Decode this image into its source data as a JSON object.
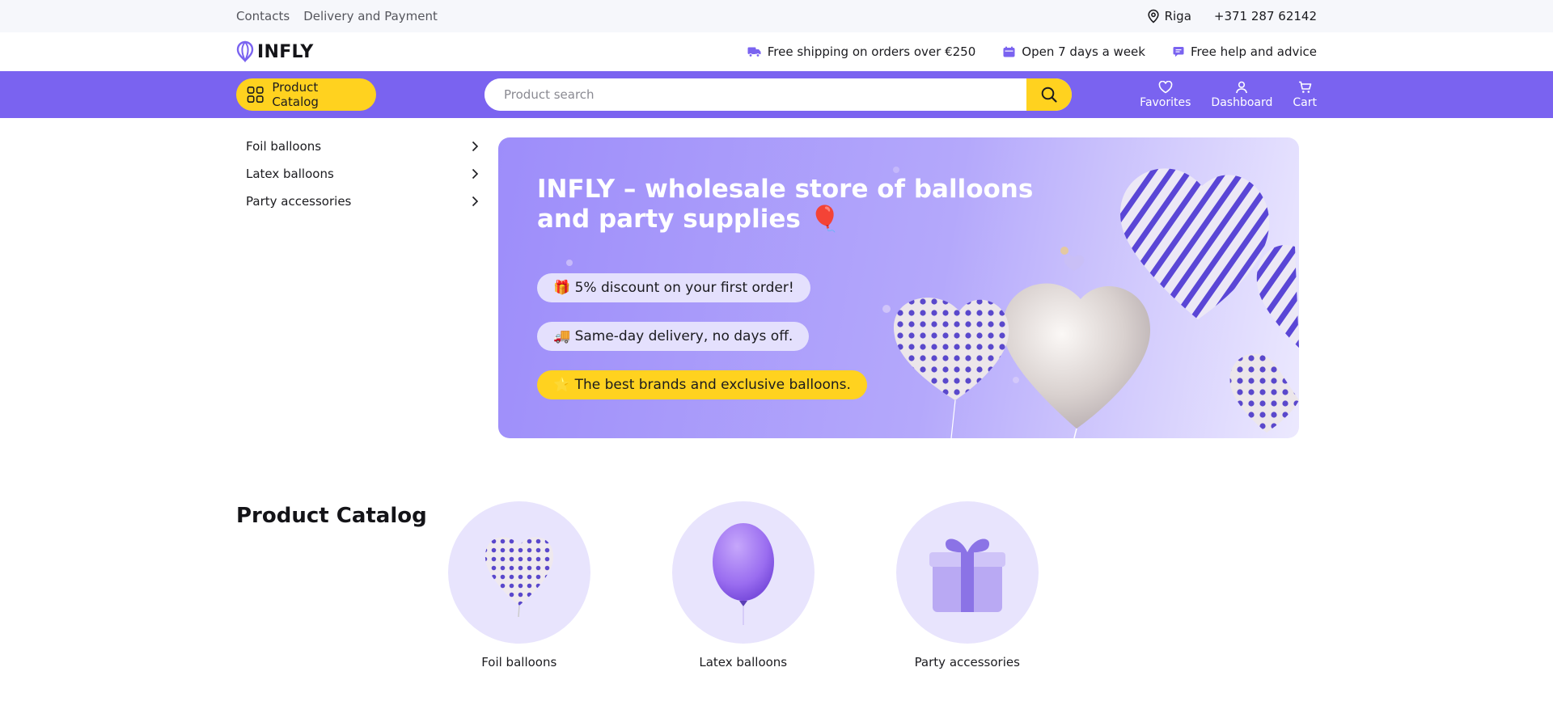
{
  "topbar": {
    "links": [
      "Contacts",
      "Delivery and Payment"
    ],
    "city": "Riga",
    "phone": "+371 287 62142"
  },
  "header": {
    "logo_text": "INFLY",
    "perks": [
      {
        "icon": "truck-icon",
        "label": "Free shipping on orders over €250"
      },
      {
        "icon": "calendar-icon",
        "label": "Open 7 days a week"
      },
      {
        "icon": "chat-icon",
        "label": "Free help and advice"
      }
    ]
  },
  "navbar": {
    "catalog_label": "Product Catalog",
    "search_placeholder": "Product search",
    "actions": [
      {
        "icon": "heart-icon",
        "label": "Favorites"
      },
      {
        "icon": "user-icon",
        "label": "Dashboard"
      },
      {
        "icon": "cart-icon",
        "label": "Cart"
      }
    ]
  },
  "sidebar": {
    "items": [
      "Foil balloons",
      "Latex balloons",
      "Party accessories"
    ]
  },
  "hero": {
    "title": "INFLY – wholesale store of balloons and party supplies 🎈",
    "pills": [
      "🎁 5% discount on your first order!",
      "🚚 Same-day delivery, no days off.",
      "⭐ The best brands and exclusive balloons."
    ]
  },
  "catalog": {
    "title": "Product Catalog",
    "categories": [
      "Foil balloons",
      "Latex balloons",
      "Party accessories"
    ]
  },
  "colors": {
    "accent_purple": "#7a63f0",
    "accent_yellow": "#ffd21f"
  }
}
